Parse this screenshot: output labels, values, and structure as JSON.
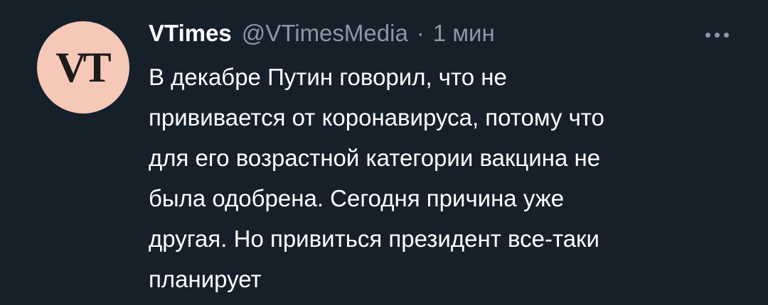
{
  "tweet": {
    "avatar_text": "VT",
    "display_name": "VTimes",
    "handle": "@VTimesMedia",
    "separator": "·",
    "time": "1 мин",
    "text_lines": [
      "В декабре Путин говорил, что не",
      "прививается от коронавируса, потому что",
      "для его возрастной категории вакцина не",
      "была одобрена. Сегодня причина уже",
      "другая. Но привиться президент все-таки",
      "планирует"
    ]
  },
  "icons": {
    "more": "more-horizontal-icon"
  },
  "colors": {
    "background": "#15202b",
    "primary_text": "#ffffff",
    "secondary_text": "#8b98a5",
    "avatar_bg": "#f5c8b8"
  }
}
